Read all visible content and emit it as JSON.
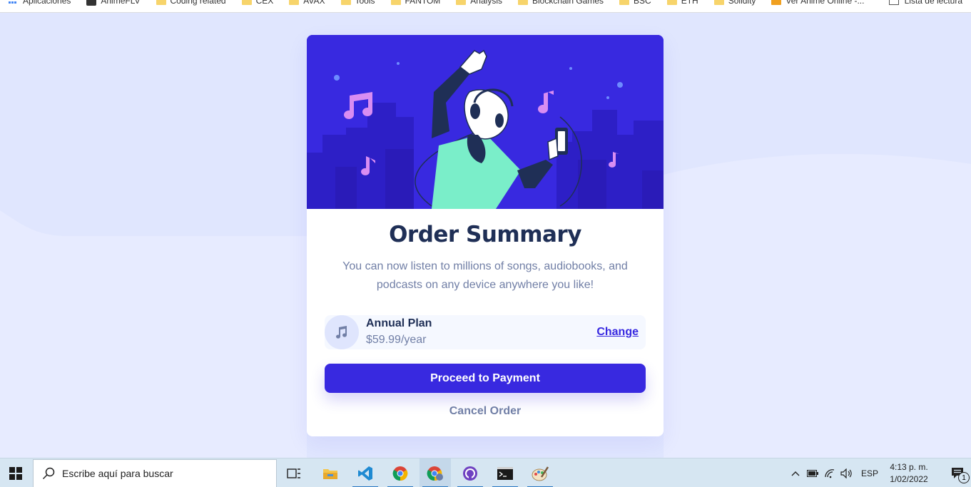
{
  "bookmarks": {
    "items": [
      "Aplicaciones",
      "AnimeFLV",
      "Coding related",
      "CEX",
      "AVAX",
      "Tools",
      "FANTOM",
      "Analysis",
      "Blockchain Games",
      "BSC",
      "ETH",
      "Solidity",
      "Ver Anime Online -..."
    ],
    "reading_list": "Lista de lectura"
  },
  "card": {
    "title": "Order Summary",
    "description": "You can now listen to millions of songs, audiobooks, and podcasts on any device anywhere you like!",
    "plan": {
      "icon": "music-note-icon",
      "name": "Annual Plan",
      "price": "$59.99/year",
      "change_label": "Change"
    },
    "proceed_label": "Proceed to Payment",
    "cancel_label": "Cancel Order"
  },
  "taskbar": {
    "search_placeholder": "Escribe aquí para buscar",
    "apps": [
      "task-view-icon",
      "file-explorer-icon",
      "vscode-icon",
      "chrome-icon",
      "chrome-profile-icon",
      "github-desktop-icon",
      "terminal-icon",
      "paint-icon"
    ],
    "language": "ESP",
    "time": "4:13 p. m.",
    "date": "1/02/2022",
    "notification_count": "1"
  },
  "colors": {
    "accent": "#3829e0",
    "title": "#1f2f56",
    "muted": "#717fa6",
    "background": "#e0e6fe"
  }
}
